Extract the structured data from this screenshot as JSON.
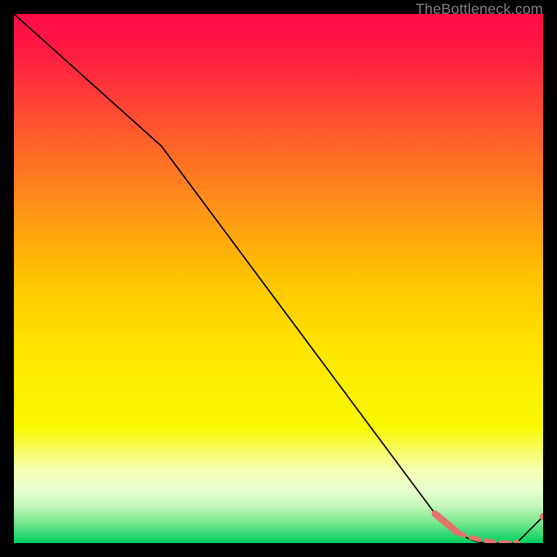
{
  "watermark": "TheBottleneck.com",
  "colors": {
    "page_bg": "#000000",
    "line": "#000000",
    "marker_fill": "#e2746c",
    "marker_stroke": "#e2746c",
    "watermark": "#808080"
  },
  "chart_data": {
    "type": "line",
    "title": "",
    "xlabel": "",
    "ylabel": "",
    "xlim": [
      0,
      100
    ],
    "ylim": [
      0,
      100
    ],
    "grid": false,
    "legend": false,
    "background_gradient": {
      "from_top": "#ff0a46",
      "mid": "#ffe000",
      "to_bottom": "#00d060"
    },
    "series": [
      {
        "name": "curve",
        "x": [
          0,
          28,
          80,
          88,
          95,
          100
        ],
        "values": [
          100,
          75,
          5,
          0,
          0,
          5
        ],
        "style": "solid-black-thin"
      },
      {
        "name": "highlight-thick",
        "x": [
          80,
          83
        ],
        "values": [
          5,
          2.5
        ],
        "style": "thick-salmon"
      },
      {
        "name": "highlight-dashed",
        "x": [
          83,
          95
        ],
        "values": [
          2.5,
          0
        ],
        "style": "dashed-salmon"
      }
    ],
    "markers": [
      {
        "x": 95,
        "y": 0
      },
      {
        "x": 100,
        "y": 5
      }
    ]
  }
}
